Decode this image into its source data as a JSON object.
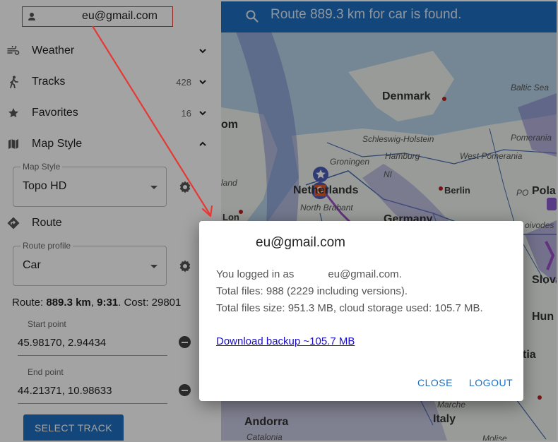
{
  "account": {
    "email": "eu@gmail.com"
  },
  "menu": [
    {
      "label": "Weather",
      "count": "",
      "icon": "wind-icon",
      "expanded": false
    },
    {
      "label": "Tracks",
      "count": "428",
      "icon": "walk-icon",
      "expanded": false
    },
    {
      "label": "Favorites",
      "count": "16",
      "icon": "star-icon",
      "expanded": false
    },
    {
      "label": "Map Style",
      "count": "",
      "icon": "map-icon",
      "expanded": true
    }
  ],
  "map_style": {
    "legend": "Map Style",
    "value": "Topo HD"
  },
  "route": {
    "label": "Route",
    "profile_legend": "Route profile",
    "profile_value": "Car",
    "info_prefix": "Route: ",
    "distance": "889.3 km",
    "sep": ", ",
    "time": "9:31",
    "cost_text": ". Cost: 29801",
    "start_label": "Start point",
    "start_value": "45.98170, 2.94434",
    "end_label": "End point",
    "end_value": "44.21371, 10.98633",
    "select_track": "SELECT TRACK"
  },
  "search": {
    "text": "Route 889.3 km for car is found."
  },
  "map_labels": {
    "denmark": "Denmark",
    "baltic": "Baltic Sea",
    "om": "om",
    "schleswig": "Schleswig-Holstein",
    "hamburg": "Hamburg",
    "west_pomerania": "West Pomerania",
    "pomerania": "Pomerania",
    "groningen": "Groningen",
    "ni": "NI",
    "netherlands": "Netherlands",
    "berlin": "Berlin",
    "po": "PO",
    "pola": "Pola",
    "land": "land",
    "north_brabant": "North Brabant",
    "lon": "Lon",
    "germany": "Germany",
    "voivodes": "oivodes",
    "slova": "Slova",
    "hun": "Hun",
    "tia": "tia",
    "marche": "Marche",
    "andorra": "Andorra",
    "italy": "Italy",
    "catalonia": "Catalonia",
    "molise": "Molise"
  },
  "dialog": {
    "title": "eu@gmail.com",
    "logged_prefix": "You logged in as",
    "logged_email": "eu@gmail.com.",
    "files": "Total files: 988 (2229 including versions).",
    "size": "Total files size: 951.3 MB, cloud storage used: 105.7 MB.",
    "download": "Download backup ~105.7 MB",
    "close": "CLOSE",
    "logout": "LOGOUT"
  },
  "colors": {
    "accent": "#1e6fc0",
    "annotation": "#e53935",
    "link": "#1a0dcc"
  }
}
